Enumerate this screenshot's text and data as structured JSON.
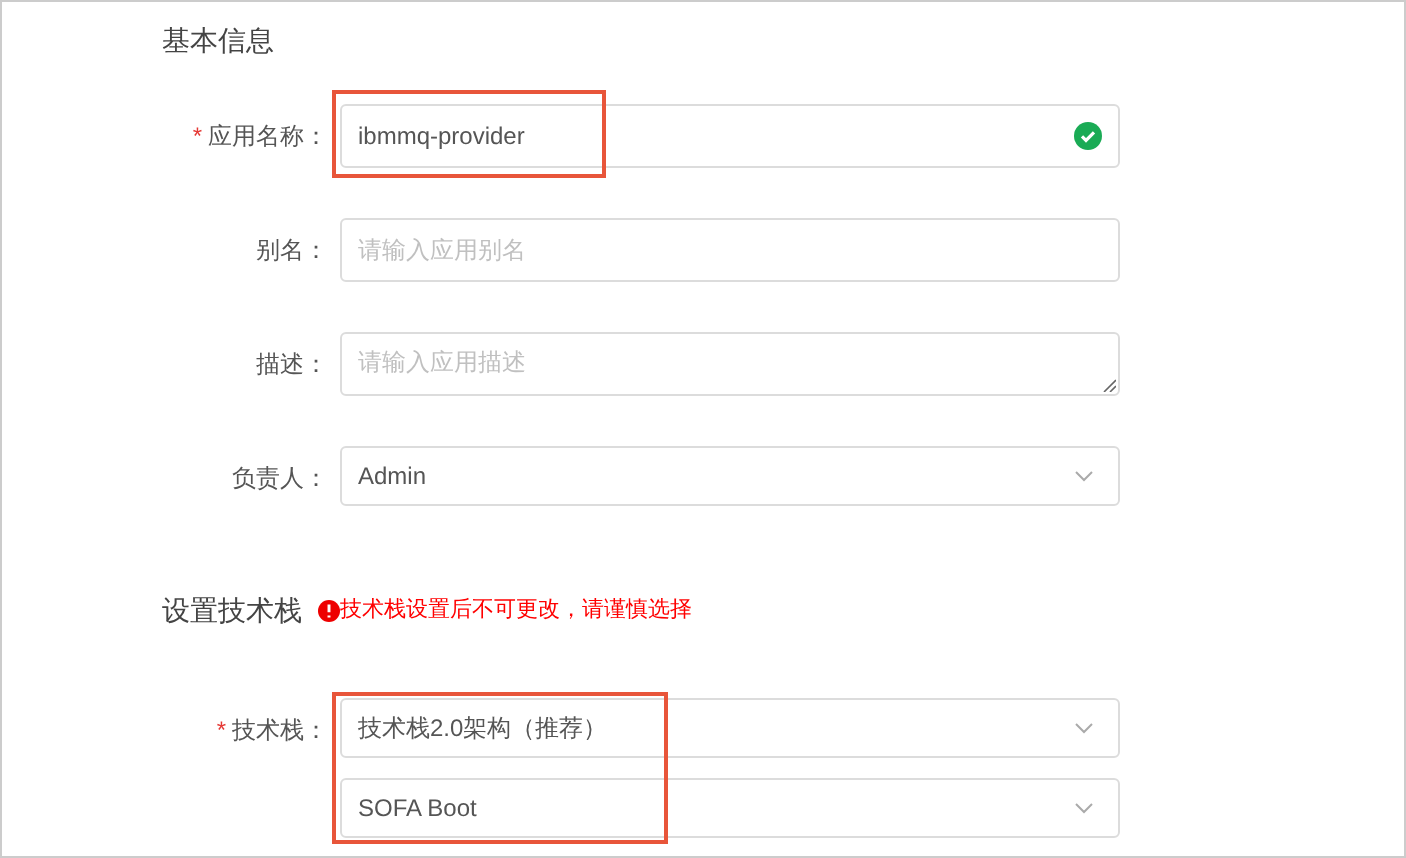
{
  "sections": [
    {
      "title": "基本信息",
      "fields": [
        {
          "kind": "input",
          "label": "应用名称：",
          "required_mark": "*",
          "value": "ibmmq-provider",
          "valid": true,
          "highlighted": true
        },
        {
          "kind": "input",
          "label": "别名：",
          "placeholder": "请输入应用别名",
          "valid": false,
          "highlighted": false
        },
        {
          "kind": "textarea",
          "label": "描述：",
          "placeholder": "请输入应用描述",
          "highlighted": false
        },
        {
          "kind": "select",
          "label": "负责人：",
          "values": [
            "Admin"
          ],
          "highlighted": false
        }
      ]
    },
    {
      "title": "设置技术栈",
      "warning": "技术栈设置后不可更改，请谨慎选择",
      "fields": [
        {
          "kind": "select",
          "label": "技术栈：",
          "required_mark": "*",
          "values": [
            "技术栈2.0架构（推荐）",
            "SOFA Boot"
          ],
          "highlighted": true
        }
      ]
    }
  ]
}
